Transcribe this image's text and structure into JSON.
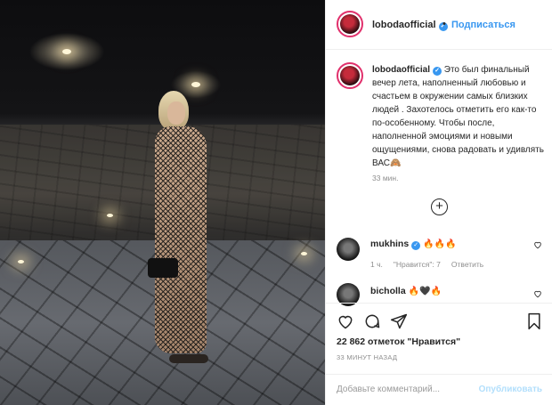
{
  "post": {
    "username": "lobodaofficial",
    "follow_label": "Подписаться",
    "header_dot": "•",
    "caption_text": "Это был финальный вечер лета, наполненный любовью и счастьем в окружении самых близких людей . Захотелось отметить его как-то по-особенному. Чтобы после, наполненной эмоциями и новыми ощущениями, снова радовать и удивлять ВАС",
    "caption_emoji": "🙈",
    "caption_time": "33 мин.",
    "more_comments_symbol": "+"
  },
  "comments": [
    {
      "username": "mukhins",
      "text": "🔥🔥🔥",
      "age": "1 ч.",
      "likes": "\"Нравится\": 7",
      "reply": "Ответить"
    },
    {
      "username": "bicholla",
      "text": "🔥🖤🔥"
    }
  ],
  "actions": {
    "likes_text": "22 862 отметок \"Нравится\"",
    "posted_ago": "33 МИНУТ НАЗАД"
  },
  "comment_box": {
    "placeholder": "Добавьте комментарий...",
    "publish_label": "Опубликовать"
  },
  "colors": {
    "accent": "#3897f0",
    "muted": "#8e8e8e",
    "publish_disabled": "#b2dffc",
    "fire": "#ff6a00"
  },
  "icons": [
    "verified-badge-icon",
    "heart-icon",
    "comment-icon",
    "share-icon",
    "bookmark-icon",
    "plus-circle-icon"
  ]
}
